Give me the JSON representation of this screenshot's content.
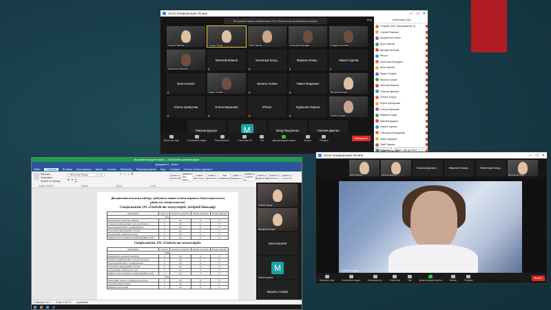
{
  "win1": {
    "title": "Zoom Конференция 48 мин",
    "meeting_bar": "Ви провели видео-конференцію 2019 | Вітаємо до професійних вступних",
    "view_label": "Вид",
    "tiles": [
      {
        "name": "Сергий Павлішн",
        "kind": "video",
        "face": "light"
      },
      {
        "name": "Тетяна Ткачук",
        "kind": "video",
        "face": "light",
        "active": true
      },
      {
        "name": "Ярій Павлюк",
        "kind": "video",
        "face": "mid"
      },
      {
        "name": "Анастасія Бородіна",
        "kind": "video",
        "face": "dark"
      },
      {
        "name": "Богдана Костенко",
        "kind": "video",
        "face": "dark"
      },
      {
        "name": "Анастасія Левченко",
        "kind": "video",
        "face": "dark"
      },
      {
        "name": "Евгений Иванов",
        "kind": "name"
      },
      {
        "name": "Элеонора Болд...",
        "kind": "name"
      },
      {
        "name": "Марина Оскар...",
        "kind": "name"
      },
      {
        "name": "Никита Гурнов",
        "kind": "name"
      },
      {
        "name": "Біла Наталія",
        "kind": "name"
      },
      {
        "name": "Кирил Голіков",
        "kind": "video",
        "face": "dark"
      },
      {
        "name": "Василь Голяка",
        "kind": "name"
      },
      {
        "name": "Павел Федкевич",
        "kind": "name"
      },
      {
        "name": "Вікторія Кістерій",
        "kind": "video",
        "face": "light"
      },
      {
        "name": "Елена Арнаутова",
        "kind": "name"
      },
      {
        "name": "Елена Баранова",
        "kind": "name"
      },
      {
        "name": "iPhone",
        "kind": "name"
      },
      {
        "name": "Куракова Лариса",
        "kind": "name"
      },
      {
        "name": "Оксана Гріщук",
        "kind": "video",
        "face": "mid"
      },
      {
        "name": "Максим Додчук",
        "kind": "name"
      },
      {
        "name": "Марія Кукувна",
        "kind": "letter",
        "letter": "M"
      },
      {
        "name": "Влад Продченко",
        "kind": "name"
      },
      {
        "name": "Гапонов Дмитро",
        "kind": "name"
      }
    ],
    "toolbar": [
      {
        "label": "Включить звук",
        "green": false
      },
      {
        "label": "Остановить видео",
        "green": false
      },
      {
        "label": "Безопасность",
        "green": false
      },
      {
        "label": "Участники 26",
        "green": false
      },
      {
        "label": "Чат",
        "green": false
      },
      {
        "label": "Демонстрация экрана",
        "green": true
      },
      {
        "label": "Запись",
        "green": false
      },
      {
        "label": "Реакции",
        "green": false
      }
    ],
    "end_button": "Завершить",
    "participants": {
      "header": "Участники (26)",
      "items": [
        "Голубєв Олег (Организатор, я)",
        "Сергий Павлішн",
        "Богдана Костенко",
        "Біла Наталія",
        "Вікторія Кістерій",
        "iPhone",
        "Анастасія Бородіна",
        "Біла Наталія",
        "Кирил Голіков",
        "Василь Голяка",
        "Евгений Иванов",
        "Гапонов Дмитро",
        "Тетяна Ткачук",
        "Елена Арнаутова",
        "Елена Баранова",
        "Марина Оскар",
        "Максим Додчук",
        "Никита Гурнов",
        "Элеонора Болдорєва",
        "Марія Кукувна",
        "Ярій Павлюк",
        "Павел Федкевич"
      ],
      "invite": "Пригласить",
      "mute_all": "Выкл. звук для всех",
      "more": "..."
    }
  },
  "win2": {
    "green_bar": "Вы демонстрируете экран — Остановить демонстрацию",
    "title": "Документ1 - Word",
    "tabs": [
      "Файл",
      "Главная",
      "Вставка",
      "Конструктор",
      "Макет",
      "Ссылки",
      "Рассылки",
      "Рецензирование",
      "Вид",
      "Справка",
      "Что вы хотите сделать?"
    ],
    "selected_tab": 1,
    "clipboard": [
      "Вырезать",
      "Копировать",
      "Формат по образцу"
    ],
    "font_name": "Times New Roman",
    "font_size": "12",
    "group_labels": [
      "Буфер обмена",
      "Шрифт",
      "Абзац",
      "Стили"
    ],
    "styles": [
      {
        "sample": "AaBbCcl",
        "name": "Обычный"
      },
      {
        "sample": "AaBbCcl",
        "name": "Без инте..."
      },
      {
        "sample": "AaBbC",
        "name": "Заголово..."
      },
      {
        "sample": "AaBbCc",
        "name": "Заголово..."
      },
      {
        "sample": "AaB",
        "name": "Название"
      },
      {
        "sample": "AaBbCc",
        "name": "Подзагол..."
      },
      {
        "sample": "AaBbCcl",
        "name": "Слабое в..."
      },
      {
        "sample": "AaBbCcl",
        "name": "Выделение"
      },
      {
        "sample": "AaBbCcl",
        "name": "Сильное..."
      },
      {
        "sample": "AaBbCcl",
        "name": "Строгий"
      }
    ],
    "doc": {
      "heading": "Дисципліни вільного вибору здобувача вищої освіти першого (бакалаврського) рівня (за спеціальністю)",
      "subheading1": "Спеціальність 193 «Геодезія та землеустрій» (вечірній бакалавр)",
      "subheading2": "Спеціальність 193 «Геодезія та землеустрій»",
      "columns": [
        "Дисципліна",
        "Семестр",
        "Кількість кредитів",
        "Форма контролю",
        "Номер кафедри"
      ],
      "course2_label": "2 курс",
      "course3_label": "3 курс",
      "course4_label": "4 курс",
      "table1": [
        [
          "Конкурентні геодезичні прилади",
          "4",
          "4,0",
          "Іс",
          "17"
        ],
        [
          "Основи геоінформатики та ресурсознавства",
          "4",
          "4,0",
          "Іс",
          "17"
        ],
        [
          "Проектування ліній з геоінформацією",
          "4",
          "4,0",
          "Іс",
          "17"
        ],
        [
          "Геодезична інформаційна система",
          "4",
          "4,0",
          "Іс",
          "17"
        ],
        [
          "Інтерактивні геофізичні методи",
          "4",
          "4,0",
          "Іс",
          "17"
        ],
        [
          "Цифрове прогнозування геоінформаційних робіт",
          "4",
          "4,0",
          "Іс",
          "17"
        ]
      ],
      "table2": [
        [
          "Конкурентні геодезичні прилади",
          "4",
          "4,0",
          "Іс",
          "17"
        ],
        [
          "Основи геоінформатики та ресурсознавства",
          "4",
          "4,0",
          "Іс",
          "17"
        ],
        [
          "Проектування ліній з геоінформацією",
          "4",
          "4,0",
          "Іс",
          "17"
        ],
        [
          "Геодезична інформаційна система",
          "4",
          "4,0",
          "Іс",
          "17"
        ],
        [
          "Інтерактивні геофізичні методи",
          "4",
          "4,0",
          "Іс",
          "17"
        ],
        [
          "Цифрове прогнозування геоінформаційних робіт",
          "4",
          "4,0",
          "Іс",
          "17"
        ]
      ],
      "table3": [
        [
          "Моніторинг земель та природних ресурсів",
          "5",
          "4,0",
          "Іс",
          "17"
        ],
        [
          "Землевпорядні розвідки",
          "5",
          "4,0",
          "Іс",
          "17"
        ],
        [
          "Цифрова картографія",
          "5",
          "4,0",
          "Іс",
          "17"
        ]
      ]
    },
    "status_left": "Страница 1 из 2",
    "status_words": "Слово 1 из 371",
    "status_lang": "украинский",
    "side_tiles": [
      {
        "name": "Тетяна Ткачук",
        "kind": "video"
      },
      {
        "name": "Вікторія Кістерій",
        "kind": "video"
      },
      {
        "name": "Біла Наталія",
        "kind": "name"
      },
      {
        "name": "Марія Кукувна",
        "kind": "letter",
        "letter": "M"
      },
      {
        "name": "Василь Голяка",
        "kind": "name"
      }
    ]
  },
  "win3": {
    "title": "Zoom Конференция 48 мин",
    "strip": [
      {
        "name": "Ярій Павлюк",
        "kind": "video"
      },
      {
        "name": "Гапонов Дмитро",
        "kind": "video"
      },
      {
        "name": "Корска Дорожн...",
        "kind": "name"
      },
      {
        "name": "Марина Оскар...",
        "kind": "name"
      },
      {
        "name": "Элеонора Болд...",
        "kind": "name"
      },
      {
        "name": "Вікторія Кістерій",
        "kind": "video"
      }
    ],
    "speaker_name": "Тетяна Ткачук",
    "toolbar": [
      "Включить звук",
      "Остановить видео",
      "Безопасность",
      "Участники",
      "Чат",
      "Демонстрация экрана",
      "Запись",
      "Реакции"
    ],
    "end_button": "Выйти",
    "clock": "7:09 29.11.2020"
  }
}
